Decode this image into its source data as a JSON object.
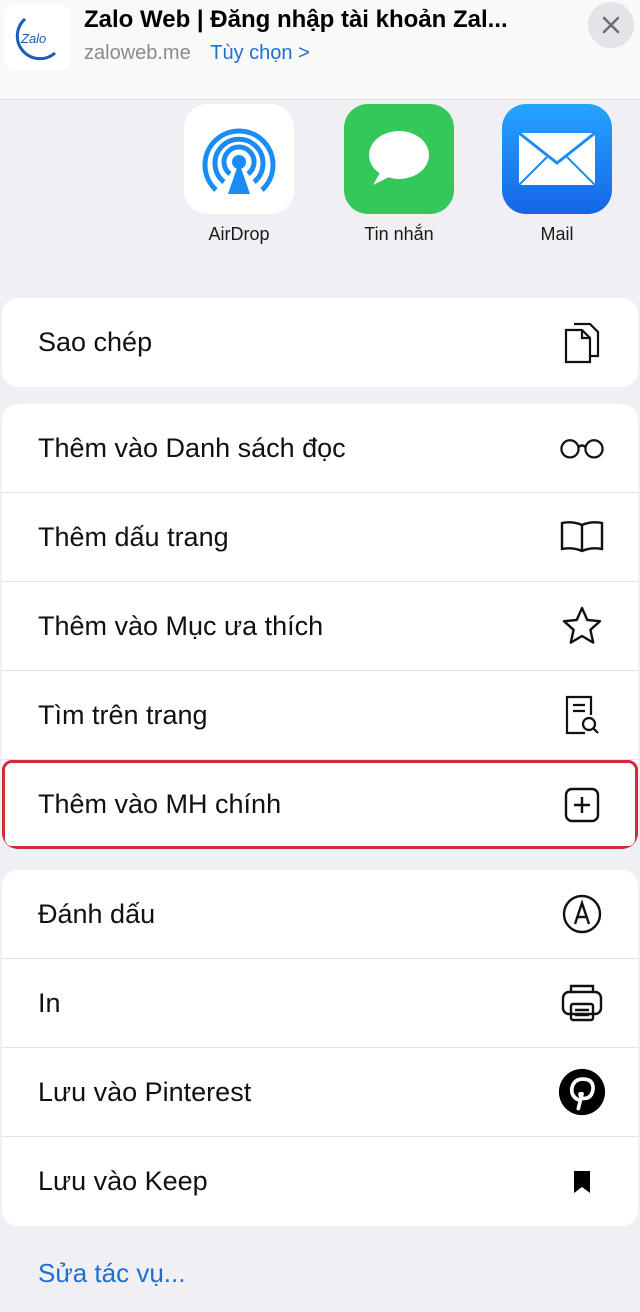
{
  "header": {
    "app_icon_text": "Zalo",
    "title": "Zalo Web | Đăng nhập tài khoản Zal...",
    "domain": "zaloweb.me",
    "options_label": "Tùy chọn >"
  },
  "share_targets": [
    {
      "label": "AirDrop",
      "icon": "airdrop-icon"
    },
    {
      "label": "Tin nhắn",
      "icon": "messages-icon"
    },
    {
      "label": "Mail",
      "icon": "mail-icon"
    }
  ],
  "groups": [
    {
      "items": [
        {
          "label": "Sao chép",
          "icon": "copy-icon"
        }
      ]
    },
    {
      "items": [
        {
          "label": "Thêm vào Danh sách đọc",
          "icon": "reading-list-icon"
        },
        {
          "label": "Thêm dấu trang",
          "icon": "book-icon"
        },
        {
          "label": "Thêm vào Mục ưa thích",
          "icon": "star-icon"
        },
        {
          "label": "Tìm trên trang",
          "icon": "find-on-page-icon"
        },
        {
          "label": "Thêm vào MH chính",
          "icon": "add-square-icon",
          "highlighted": true
        }
      ]
    },
    {
      "items": [
        {
          "label": "Đánh dấu",
          "icon": "markup-icon"
        },
        {
          "label": "In",
          "icon": "print-icon"
        },
        {
          "label": "Lưu vào Pinterest",
          "icon": "pinterest-icon"
        },
        {
          "label": "Lưu vào Keep",
          "icon": "bookmark-icon"
        }
      ]
    }
  ],
  "edit_actions_label": "Sửa tác vụ...",
  "colors": {
    "accent_blue": "#1f6fd1",
    "highlight_red": "#cf2c3a",
    "messages_green": "#34c759",
    "mail_blue": "#1a8cf5"
  }
}
